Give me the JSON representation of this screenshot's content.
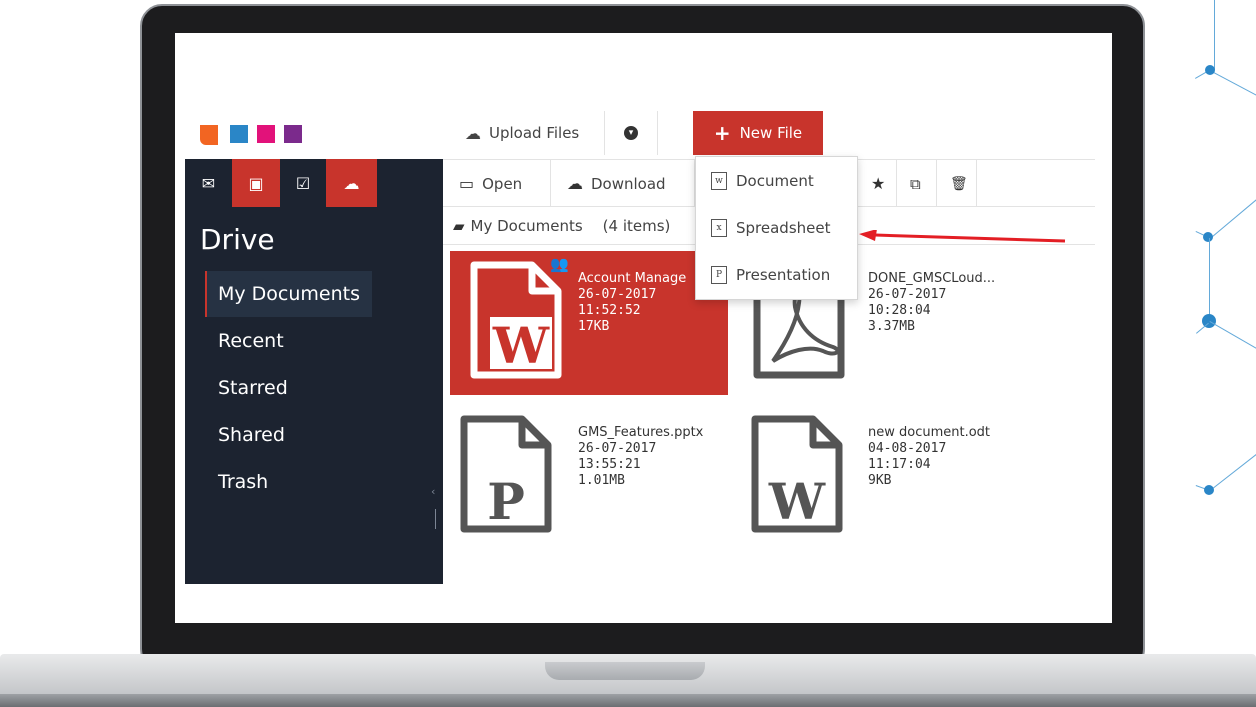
{
  "toolbar": {
    "upload_label": "Upload Files",
    "new_file_label": "New File"
  },
  "sidebar": {
    "title": "Drive",
    "items": [
      {
        "label": "My Documents",
        "active": true
      },
      {
        "label": "Recent"
      },
      {
        "label": "Starred"
      },
      {
        "label": "Shared"
      },
      {
        "label": "Trash"
      }
    ]
  },
  "actions": {
    "open_label": "Open",
    "download_label": "Download"
  },
  "path": {
    "folder": "My Documents",
    "count": "(4 items)"
  },
  "new_file_menu": {
    "items": [
      "Document",
      "Spreadsheet",
      "Presentation"
    ]
  },
  "files": [
    {
      "name": "Account Manage",
      "date": "26-07-2017",
      "time": "11:52:52",
      "size": "17KB",
      "letter": "W",
      "selected": true
    },
    {
      "name": "DONE_GMSCLoud...",
      "date": "26-07-2017",
      "time": "10:28:04",
      "size": "3.37MB",
      "letter": "PDF"
    },
    {
      "name": "GMS_Features.pptx",
      "date": "26-07-2017",
      "time": "13:55:21",
      "size": "1.01MB",
      "letter": "P"
    },
    {
      "name": "new document.odt",
      "date": "04-08-2017",
      "time": "11:17:04",
      "size": "9KB",
      "letter": "W"
    }
  ],
  "colors": {
    "accent": "#c8342c",
    "sidebar_bg": "#1c2330",
    "logo": [
      "#f26522",
      "#2a86c7",
      "#e2127a",
      "#7b2a8c"
    ]
  }
}
